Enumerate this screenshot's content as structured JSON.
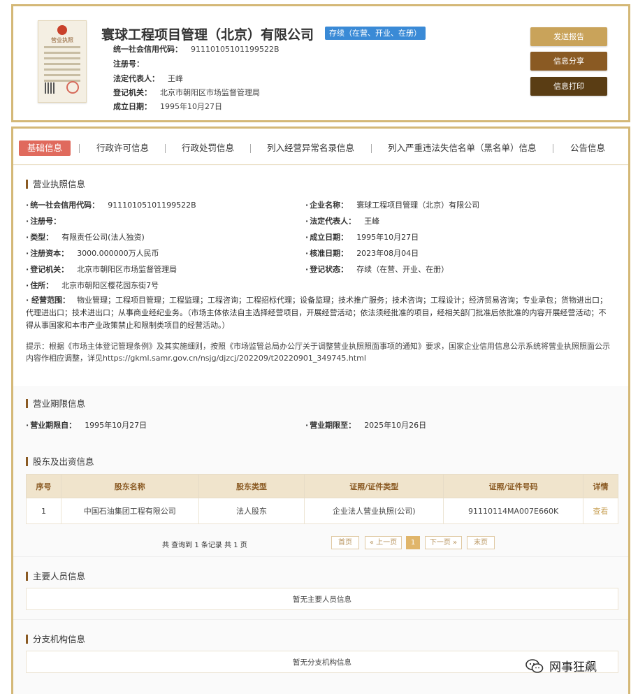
{
  "header": {
    "company_name": "寰球工程项目管理（北京）有限公司",
    "status": "存续（在营、开业、在册）",
    "rows": [
      {
        "label": "统一社会信用代码：",
        "value": "91110105101199522B"
      },
      {
        "label": "注册号：",
        "value": ""
      },
      {
        "label": "法定代表人：",
        "value": "王峰"
      },
      {
        "label": "登记机关：",
        "value": "北京市朝阳区市场监督管理局"
      },
      {
        "label": "成立日期：",
        "value": "1995年10月27日"
      }
    ],
    "license_title": "营业执照",
    "buttons": {
      "report": "发送报告",
      "share": "信息分享",
      "print": "信息打印"
    }
  },
  "tabs": [
    "基础信息",
    "行政许可信息",
    "行政处罚信息",
    "列入经营异常名录信息",
    "列入严重违法失信名单（黑名单）信息",
    "公告信息"
  ],
  "license_section": {
    "title": "营业执照信息",
    "left": [
      {
        "label": "统一社会信用代码：",
        "value": "91110105101199522B"
      },
      {
        "label": "注册号：",
        "value": ""
      },
      {
        "label": "类型：",
        "value": "有限责任公司(法人独资)"
      },
      {
        "label": "注册资本：",
        "value": "3000.000000万人民币"
      },
      {
        "label": "登记机关：",
        "value": "北京市朝阳区市场监督管理局"
      },
      {
        "label": "住所：",
        "value": "北京市朝阳区樱花园东街7号"
      }
    ],
    "right": [
      {
        "label": "企业名称：",
        "value": "寰球工程项目管理（北京）有限公司"
      },
      {
        "label": "法定代表人：",
        "value": "王峰"
      },
      {
        "label": "成立日期：",
        "value": "1995年10月27日"
      },
      {
        "label": "核准日期：",
        "value": "2023年08月04日"
      },
      {
        "label": "登记状态：",
        "value": "存续（在营、开业、在册）"
      }
    ],
    "scope_label": "经营范围：",
    "scope_value": "物业管理；工程项目管理；工程监理；工程咨询；工程招标代理；设备监理；技术推广服务；技术咨询；工程设计；经济贸易咨询；专业承包；货物进出口；代理进出口；技术进出口；从事商业经纪业务。（市场主体依法自主选择经营项目，开展经营活动；依法须经批准的项目，经相关部门批准后依批准的内容开展经营活动；不得从事国家和本市产业政策禁止和限制类项目的经营活动。）",
    "note": "提示：根据《市场主体登记管理条例》及其实施细则，按照《市场监管总局办公厅关于调整营业执照照面事项的通知》要求，国家企业信用信息公示系统将营业执照照面公示内容作相应调整，详见https://gkml.samr.gov.cn/nsjg/djzcj/202209/t20220901_349745.html"
  },
  "period_section": {
    "title": "营业期限信息",
    "from_label": "营业期限自：",
    "from_value": "1995年10月27日",
    "to_label": "营业期限至：",
    "to_value": "2025年10月26日"
  },
  "shareholder_section": {
    "title": "股东及出资信息",
    "columns": [
      "序号",
      "股东名称",
      "股东类型",
      "证照/证件类型",
      "证照/证件号码",
      "详情"
    ],
    "rows": [
      [
        "1",
        "中国石油集团工程有限公司",
        "法人股东",
        "企业法人营业执照(公司)",
        "91110114MA007E660K",
        "查看"
      ]
    ],
    "pager": {
      "info": "共 查询到 1 条记录 共 1 页",
      "first": "首页",
      "prev": "« 上一页",
      "current": "1",
      "next": "下一页 »",
      "last": "末页"
    }
  },
  "staff_section": {
    "title": "主要人员信息",
    "empty": "暂无主要人员信息"
  },
  "branch_section": {
    "title": "分支机构信息",
    "empty": "暂无分支机构信息"
  },
  "watermark": "网事狂飙",
  "colors": {
    "gold_border": "#d4b877",
    "active_tab": "#e06a5d",
    "status_badge": "#3a8ad6",
    "btn_report": "#c9a35a",
    "btn_share": "#8a5a23",
    "btn_print": "#5a3d14"
  }
}
